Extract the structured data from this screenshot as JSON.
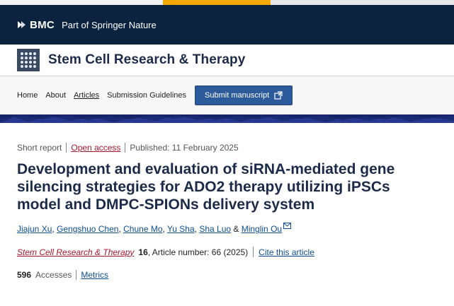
{
  "brand": {
    "bmc_text": "BMC",
    "bmc_subtitle": "Part of Springer Nature"
  },
  "journal": {
    "name": "Stem Cell Research & Therapy"
  },
  "nav": {
    "items": [
      "Home",
      "About",
      "Articles",
      "Submission Guidelines"
    ],
    "active": "Articles",
    "submit_label": "Submit manuscript"
  },
  "article": {
    "type": "Short report",
    "access": "Open access",
    "published": "Published: 11 February 2025",
    "title": "Development and evaluation of siRNA-mediated gene silencing strategies for ADO2 therapy utilizing iPSCs model and DMPC-SPIONs delivery system",
    "authors": [
      "Jiajun Xu",
      "Gengshuo Chen",
      "Chune Mo",
      "Yu Sha",
      "Sha Luo",
      "Minglin Ou"
    ],
    "author_separator": ", ",
    "author_last_separator": " & ",
    "citation": {
      "journal": "Stem Cell Research & Therapy",
      "volume": "16",
      "details": ", Article number: 66 (2025)",
      "cite_label": "Cite this article"
    },
    "accesses_count": "596",
    "accesses_label": "Accesses",
    "metrics_label": "Metrics"
  },
  "colors": {
    "bmc_bar": "#0c2340",
    "title": "#1c2b4a",
    "link_red": "#a5172d",
    "link_blue": "#0c4d90",
    "button": "#2c5a9b",
    "band": "#1b2a74"
  }
}
